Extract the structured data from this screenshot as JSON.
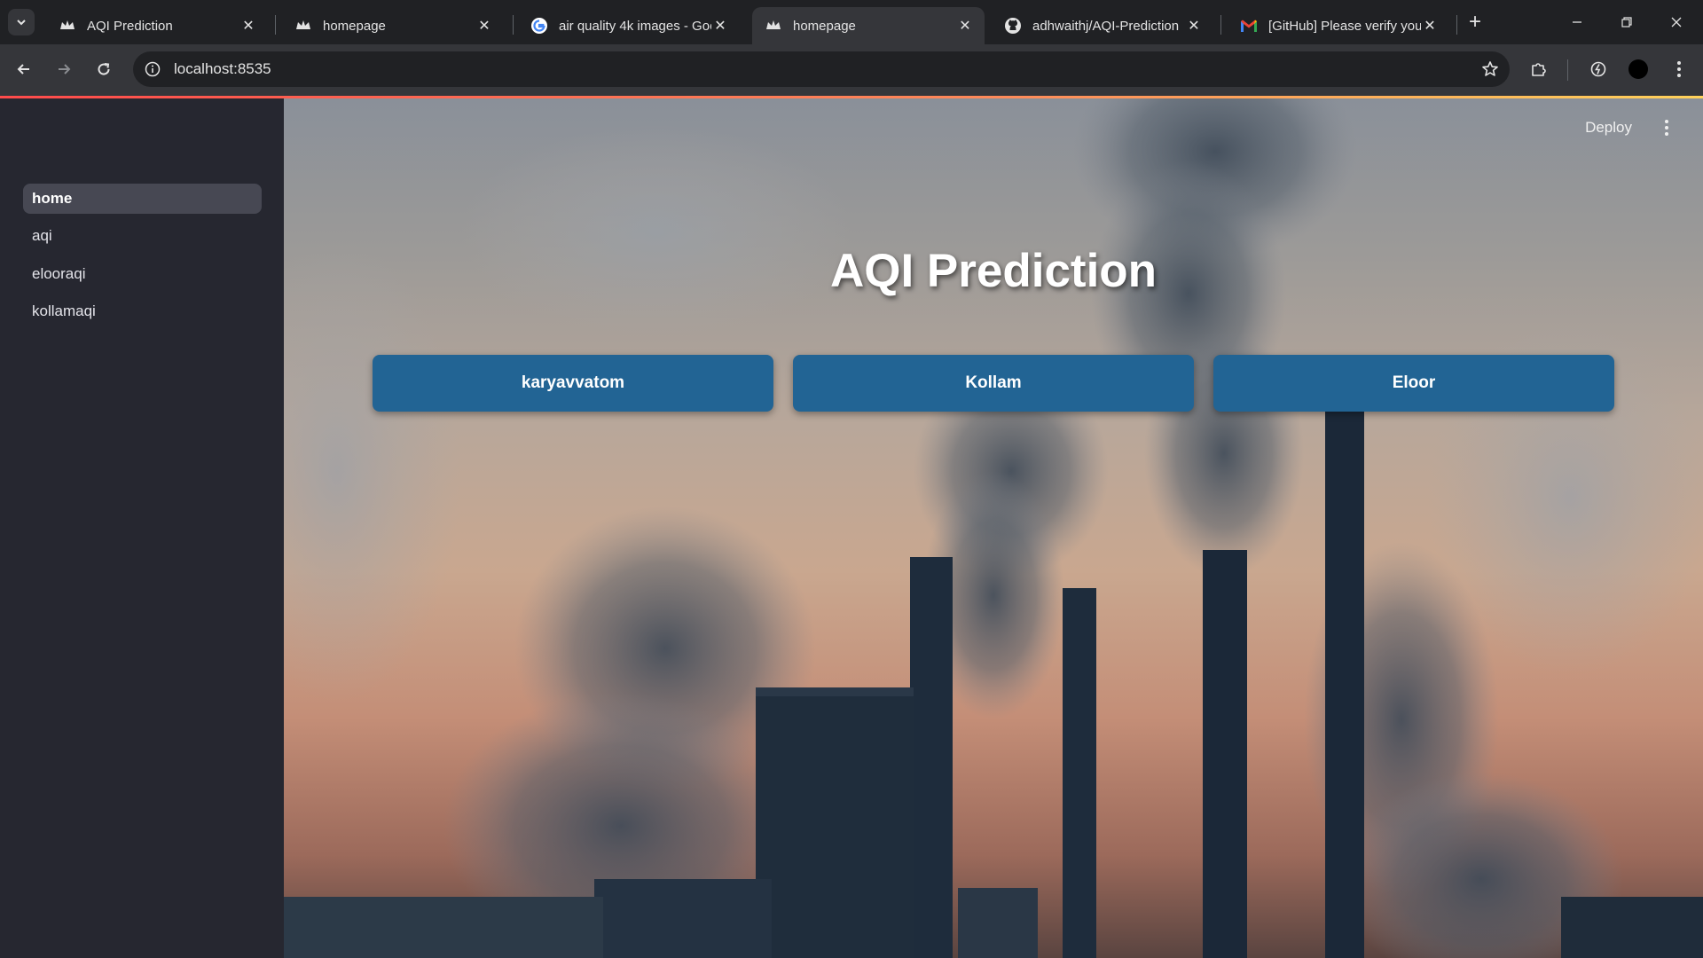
{
  "browser": {
    "tabs": [
      {
        "title": "AQI Prediction",
        "icon": "streamlit-crown-icon",
        "active": false
      },
      {
        "title": "homepage",
        "icon": "streamlit-crown-icon",
        "active": false
      },
      {
        "title": "air quality 4k images - Goo",
        "icon": "google-icon",
        "active": false
      },
      {
        "title": "homepage",
        "icon": "streamlit-crown-icon",
        "active": true
      },
      {
        "title": "adhwaithj/AQI-Prediction",
        "icon": "github-icon",
        "active": false
      },
      {
        "title": "[GitHub] Please verify your",
        "icon": "gmail-icon",
        "active": false
      }
    ],
    "url": "localhost:8535"
  },
  "sidebar": {
    "items": [
      {
        "label": "home",
        "active": true
      },
      {
        "label": "aqi",
        "active": false
      },
      {
        "label": "elooraqi",
        "active": false
      },
      {
        "label": "kollamaqi",
        "active": false
      }
    ]
  },
  "header": {
    "deploy_label": "Deploy"
  },
  "main": {
    "title": "AQI Prediction",
    "buttons": [
      {
        "label": "karyavvatom"
      },
      {
        "label": "Kollam"
      },
      {
        "label": "Eloor"
      }
    ]
  },
  "colors": {
    "sidebar_bg": "#262730",
    "button_bg": "#226494",
    "chrome_bg": "#202124"
  }
}
